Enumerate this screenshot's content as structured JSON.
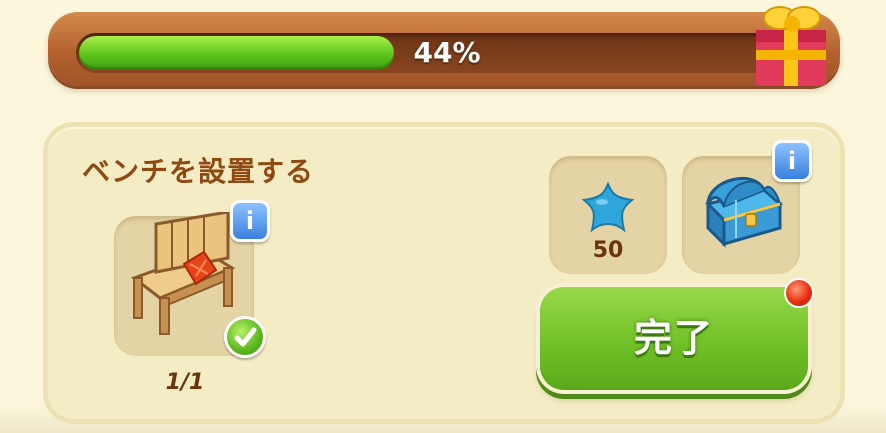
{
  "progress": {
    "label": "44%",
    "value": 0.44
  },
  "quest": {
    "title": "ベンチを設置する",
    "item": {
      "icon": "bench-icon",
      "count": "1/1",
      "status": "check-icon"
    },
    "rewards": [
      {
        "icon": "blue-star-icon",
        "amount": "50"
      },
      {
        "icon": "blue-chest-icon"
      }
    ],
    "complete_label": "完了"
  },
  "info_label": "i",
  "colors": {
    "progress_fill": "#5cc41c",
    "button": "#6fbf26",
    "title": "#8f4a12",
    "badge": "#e83010"
  }
}
